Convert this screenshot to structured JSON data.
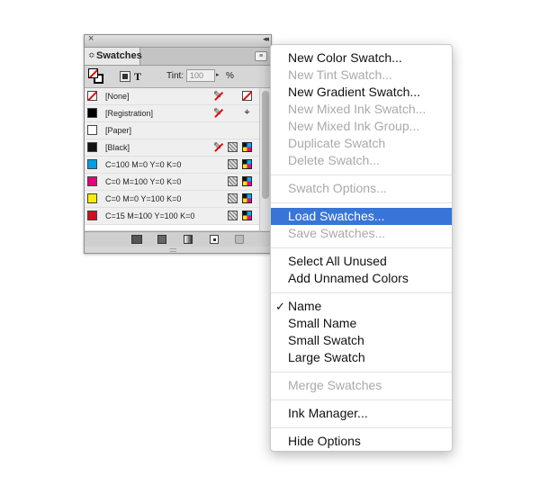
{
  "panel": {
    "close_glyph": "×",
    "collapse_glyph": "◂◂",
    "tab_arrows": "≎",
    "tab_title": "Swatches",
    "menu_button_glyph": "≡",
    "tint_label": "Tint:",
    "tint_value": "100",
    "tint_stepper": "▸",
    "tint_unit": "%",
    "text_tool": "T",
    "swatches": [
      {
        "name": "[None]",
        "color": "none",
        "icons": [
          "no-edit-icon",
          "none-icon"
        ]
      },
      {
        "name": "[Registration]",
        "color": "#000000",
        "icons": [
          "no-edit-icon",
          "registration-icon"
        ]
      },
      {
        "name": "[Paper]",
        "color": "#ffffff",
        "icons": []
      },
      {
        "name": "[Black]",
        "color": "#000000",
        "icons": [
          "no-edit-icon",
          "process-icon",
          "cmyk-icon"
        ]
      },
      {
        "name": "C=100 M=0 Y=0 K=0",
        "color": "#00a0e3",
        "icons": [
          "process-icon",
          "cmyk-icon"
        ]
      },
      {
        "name": "C=0 M=100 Y=0 K=0",
        "color": "#e3007d",
        "icons": [
          "process-icon",
          "cmyk-icon"
        ]
      },
      {
        "name": "C=0 M=0 Y=100 K=0",
        "color": "#ffed00",
        "icons": [
          "process-icon",
          "cmyk-icon"
        ]
      },
      {
        "name": "C=15 M=100 Y=100 K=0",
        "color": "#c8141e",
        "icons": [
          "process-icon",
          "cmyk-icon"
        ]
      }
    ],
    "grip_glyph": "::::::::"
  },
  "menu": {
    "items": [
      {
        "label": "New Color Swatch...",
        "enabled": true
      },
      {
        "label": "New Tint Swatch...",
        "enabled": false
      },
      {
        "label": "New Gradient Swatch...",
        "enabled": true
      },
      {
        "label": "New Mixed Ink Swatch...",
        "enabled": false
      },
      {
        "label": "New Mixed Ink Group...",
        "enabled": false
      },
      {
        "label": "Duplicate Swatch",
        "enabled": false
      },
      {
        "label": "Delete Swatch...",
        "enabled": false
      },
      {
        "label": "Swatch Options...",
        "enabled": false
      },
      {
        "label": "Load Swatches...",
        "enabled": true,
        "highlighted": true
      },
      {
        "label": "Save Swatches...",
        "enabled": false
      },
      {
        "label": "Select All Unused",
        "enabled": true
      },
      {
        "label": "Add Unnamed Colors",
        "enabled": true
      },
      {
        "label": "Name",
        "enabled": true,
        "checked": true,
        "check_glyph": "✓"
      },
      {
        "label": "Small Name",
        "enabled": true
      },
      {
        "label": "Small Swatch",
        "enabled": true
      },
      {
        "label": "Large Swatch",
        "enabled": true
      },
      {
        "label": "Merge Swatches",
        "enabled": false
      },
      {
        "label": "Ink Manager...",
        "enabled": true
      },
      {
        "label": "Hide Options",
        "enabled": true
      }
    ],
    "highlight_color": "#3875d7"
  }
}
